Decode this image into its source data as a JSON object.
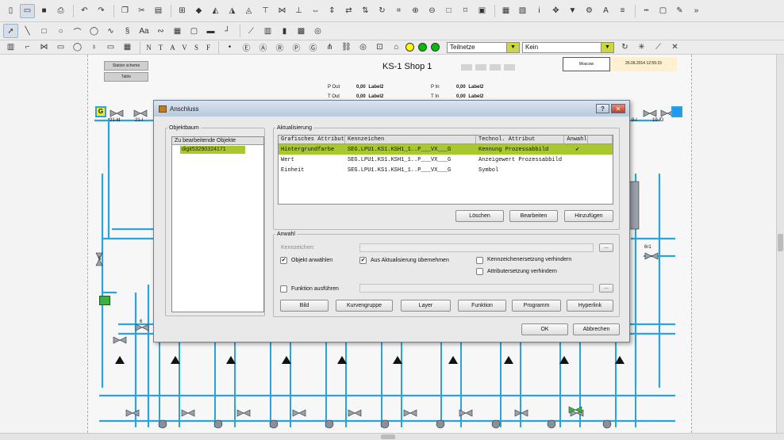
{
  "toolbar": {
    "row1_icons": [
      "new-file-icon",
      "open-folder-icon",
      "save-icon",
      "print-icon",
      "undo-icon",
      "redo-icon",
      "copy-icon",
      "cut-icon",
      "paste-icon",
      "grid-icon",
      "paint-bucket-icon",
      "align-left-icon",
      "align-center-icon",
      "align-right-icon",
      "align-top-icon",
      "align-middle-icon",
      "align-bottom-icon",
      "distribute-h-icon",
      "distribute-v-icon",
      "flip-h-icon",
      "flip-v-icon",
      "rotate-icon",
      "snap-icon",
      "zoom-in-icon",
      "zoom-out-icon",
      "zoom-fit-icon",
      "crop-icon",
      "layers-icon",
      "group-icon",
      "ungroup-icon",
      "info-icon",
      "pan-icon",
      "filter-icon",
      "settings-icon",
      "font-icon",
      "line-width-icon",
      "line-style-icon",
      "border-icon",
      "pen-icon",
      "more-icon"
    ],
    "row2_icons": [
      "select-arrow-icon",
      "line-tool-icon",
      "rectangle-tool-icon",
      "ellipse-tool-icon",
      "arc-tool-icon",
      "circle-tool-icon",
      "polyline-tool-icon",
      "symbol-tool-icon",
      "text-tool-icon",
      "curve-tool-icon",
      "table-tool-icon",
      "frame-tool-icon",
      "bar-tool-icon",
      "connector-tool-icon",
      "trend-tool-icon",
      "chart-tool-icon",
      "bar-chart-tool-icon",
      "matrix-tool-icon",
      "target-icon"
    ],
    "row3_icons": [
      "station-icon",
      "pipe-icon",
      "valve-icon",
      "pump-icon",
      "sensor-icon",
      "gauge-icon",
      "motor-icon",
      "rts-icon"
    ],
    "row3_letters": [
      "N",
      "T",
      "A",
      "V",
      "S",
      "F"
    ],
    "row3_icons_b": [
      "dot-icon",
      "e-circle-icon",
      "a-circle-icon",
      "r-circle-icon",
      "p-circle-icon",
      "g-circle-icon",
      "network-icon",
      "link-icon",
      "ring-icon",
      "lock-icon",
      "house-icon"
    ],
    "status_colors": [
      "#ffff00",
      "#00c000",
      "#00c000"
    ],
    "combo1_value": "Teilnetze",
    "combo2_value": "Kein",
    "row3_icons_c": [
      "refresh-icon",
      "star-icon",
      "trend-icon",
      "delete-icon"
    ]
  },
  "canvas": {
    "title": "KS-1 Shop 1",
    "nav_buttons": [
      "Station scheme",
      "Table"
    ],
    "header_left": "Moscow",
    "header_right": "26.09.2014 12:55:15",
    "p_out_label": "P Out",
    "t_out_label": "T Out",
    "p_in_label": "P In",
    "t_in_label": "T In",
    "value_zero": "0,00",
    "label2": "Label2",
    "left_tags": [
      "21-ld",
      "21-l"
    ],
    "right_tags": [
      "9-l",
      "19-lD"
    ],
    "g_tag": "G",
    "side_tags": [
      "5",
      "6",
      "6r1"
    ]
  },
  "dialog": {
    "title": "Anschluss",
    "help_label": "?",
    "close_label": "✕",
    "objektbaum": {
      "legend": "Objektbaum",
      "header": "Zu bearbeitende Objekte",
      "item": "digit53290324171"
    },
    "aktualisierung": {
      "legend": "Aktualisierung",
      "columns": [
        "Grafisches Attribut",
        "Kennzeichen",
        "Technol. Attribut",
        "Anwahl"
      ],
      "rows": [
        {
          "attr": "Hintergrundfarbe",
          "kennzeichen": "SEG.LPU1.KS1.KSH1_1..P___VX___G",
          "technol": "Kennung Prozessabbild",
          "anwahl": "✔"
        },
        {
          "attr": "Wert",
          "kennzeichen": "SEG.LPU1.KS1.KSH1_1..P___VX___G",
          "technol": "Anzeigewert Prozessabbild",
          "anwahl": ""
        },
        {
          "attr": "Einheit",
          "kennzeichen": "SEG.LPU1.KS1.KSH1_1..P___VX___G",
          "technol": "Symbol",
          "anwahl": ""
        }
      ],
      "btn_loeschen": "Löschen",
      "btn_bearbeiten": "Bearbeiten",
      "btn_hinzufuegen": "Hinzufügen"
    },
    "anwahl": {
      "legend": "Anwahl",
      "kennzeichen_label": "Kennzeichen:",
      "kennzeichen_value": "",
      "ellipsis": "...",
      "chk_objekt": "Objekt anwählen",
      "chk_objekt_checked": "✔",
      "chk_aus": "Aus Aktualisierung übernehmen",
      "chk_aus_checked": "✔",
      "chk_kennzeichen": "Kennzeichenersetzung verhindern",
      "chk_attribut": "Attributersetzung verhindern",
      "chk_funktion": "Funktion ausführen",
      "funktion_value": "",
      "buttons": [
        "Bild",
        "Kurvengruppe",
        "Layer",
        "Funktion",
        "Programm",
        "Hyperlink"
      ]
    },
    "btn_ok": "OK",
    "btn_abbrechen": "Abbrechen"
  }
}
